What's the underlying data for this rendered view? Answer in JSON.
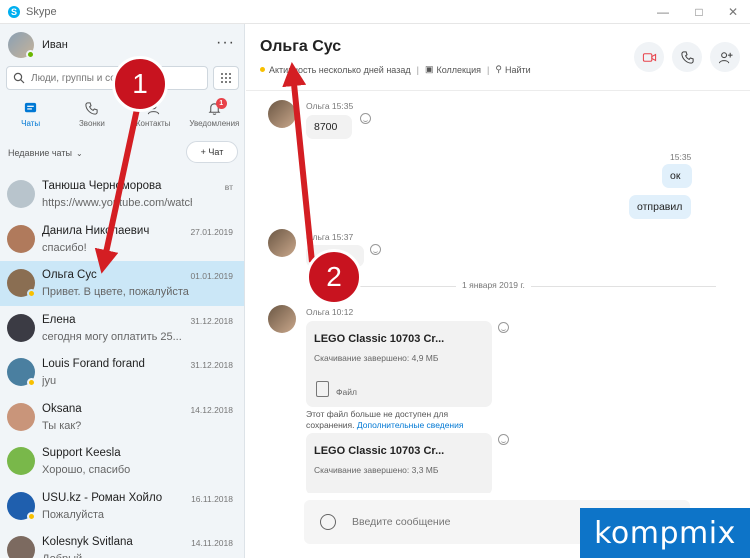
{
  "window": {
    "title": "Skype"
  },
  "profile": {
    "name": "Иван"
  },
  "search": {
    "placeholder": "Люди, группы и сообщения"
  },
  "tabs": [
    {
      "label": "Чаты",
      "icon": "chat-icon",
      "active": true
    },
    {
      "label": "Звонки",
      "icon": "phone-icon"
    },
    {
      "label": "Контакты",
      "icon": "contacts-icon"
    },
    {
      "label": "Уведомления",
      "icon": "bell-icon",
      "badge": "1"
    }
  ],
  "recent": {
    "label": "Недавние чаты",
    "new_chat": "+ Чат"
  },
  "chats": [
    {
      "name": "Танюша Черноморова",
      "preview": "https://www.youtube.com/watch?v...",
      "date": "вт",
      "avatar": "#b8c4cc"
    },
    {
      "name": "Данила Николаевич",
      "preview": "спасибо!",
      "date": "27.01.2019",
      "avatar": "#b07a5c"
    },
    {
      "name": "Ольга Сус",
      "preview": "Привет. В цвете, пожалуйста",
      "date": "01.01.2019",
      "avatar": "#8a6e52",
      "status": "away",
      "active": true
    },
    {
      "name": "Елена",
      "preview": "сегодня могу оплатить 25...",
      "date": "31.12.2018",
      "avatar": "#3b3b44"
    },
    {
      "name": "Louis Forand forand",
      "preview": "jyu",
      "date": "31.12.2018",
      "avatar": "#4a7fa0",
      "status": "away"
    },
    {
      "name": "Oksana",
      "preview": "Ты как?",
      "date": "14.12.2018",
      "avatar": "#c9957a"
    },
    {
      "name": "Support Keesla",
      "preview": "Хорошо, спасибо",
      "date": "",
      "avatar": "#79b84a"
    },
    {
      "name": "USU.kz - Роман Хойло",
      "preview": "Пожалуйста",
      "date": "16.11.2018",
      "avatar": "#1f5fae",
      "status": "away"
    },
    {
      "name": "Kolesnyk Svitlana",
      "preview": "Добрый",
      "date": "14.11.2018",
      "avatar": "#7c6a60"
    }
  ],
  "conversation": {
    "title": "Ольга Сус",
    "activity": "Активность несколько дней назад",
    "collection": "Коллекция",
    "find": "Найти",
    "messages": {
      "m1_meta": "Ольга 15:35",
      "m1_text": "8700",
      "m2_time": "15:35",
      "m2_text": "ок",
      "m3_text": "отправил",
      "m4_meta": "Ольга 15:37",
      "day_separator": "1 января 2019 г.",
      "m5_meta": "Ольга 10:12",
      "file1_name": "LEGO Classic 10703 Cr...",
      "file1_status": "Скачивание завершено: 4,9 МБ",
      "file1_kind": "Файл",
      "file_note_1": "Этот файл больше не доступен для",
      "file_note_2": "сохранения.",
      "file_note_link": "Дополнительные сведения",
      "file2_name": "LEGO Classic 10703 Cr...",
      "file2_status": "Скачивание завершено: 3,3 МБ"
    },
    "composer_placeholder": "Введите сообщение"
  },
  "annotations": {
    "step1": "1",
    "step2": "2",
    "arrow_color": "#d41e23"
  },
  "brand": {
    "text": "kompmix"
  },
  "colors": {
    "accent": "#0078d4",
    "selected_chat": "#cbe7f7",
    "sidebar_bg": "#f1f5f8"
  }
}
